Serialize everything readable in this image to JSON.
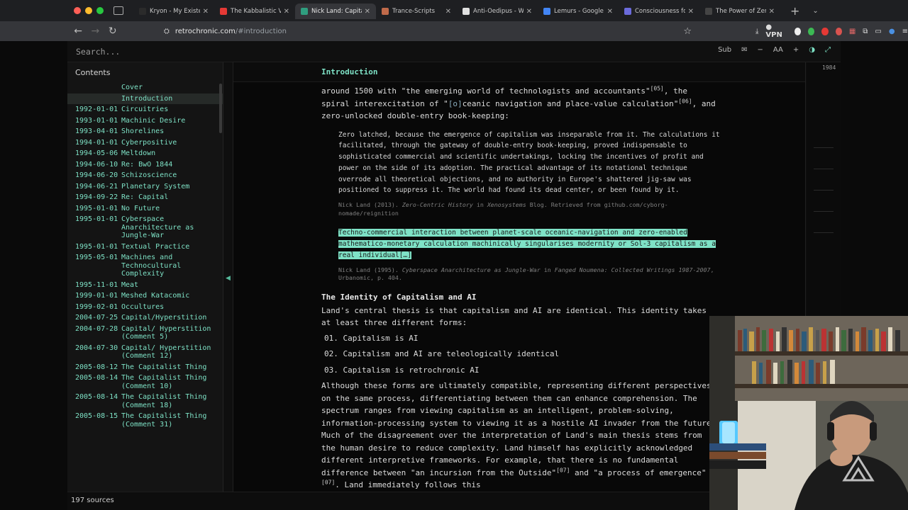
{
  "browser": {
    "tabs": [
      {
        "label": "Kryon - My Existenti",
        "favicon_color": "#2b2b2b",
        "active": false
      },
      {
        "label": "The Kabbalistic Viru",
        "favicon_color": "#e53935",
        "active": false
      },
      {
        "label": "Nick Land: Capitalis",
        "favicon_color": "#2f9e7f",
        "active": true
      },
      {
        "label": "Trance-Scripts",
        "favicon_color": "#c06a4a",
        "active": false
      },
      {
        "label": "Anti-Oedipus - Wikip",
        "favicon_color": "#e0e0e0",
        "active": false
      },
      {
        "label": "Lemurs - Google Sea",
        "favicon_color": "#4285f4",
        "active": false
      },
      {
        "label": "Consciousness for N",
        "favicon_color": "#6b6bdb",
        "active": false
      },
      {
        "label": "The Power of Zero - Chr",
        "favicon_color": "#444444",
        "active": false
      }
    ],
    "url_host": "retrochronic.com",
    "url_path": "/#introduction",
    "vpn_label": "VPN"
  },
  "app": {
    "search_placeholder": "Search...",
    "tools": {
      "sub": "Sub",
      "font": "AA"
    },
    "contents_title": "Contents",
    "toc": [
      {
        "date": "",
        "title": "Cover"
      },
      {
        "date": "",
        "title": "Introduction",
        "active": true
      },
      {
        "date": "1992-01-01",
        "title": "Circuitries"
      },
      {
        "date": "1993-01-01",
        "title": "Machinic Desire"
      },
      {
        "date": "1993-04-01",
        "title": "Shorelines"
      },
      {
        "date": "1994-01-01",
        "title": "Cyberpositive"
      },
      {
        "date": "1994-05-06",
        "title": "Meltdown"
      },
      {
        "date": "1994-06-10",
        "title": "Re: BwO 1844"
      },
      {
        "date": "1994-06-20",
        "title": "Schizoscience"
      },
      {
        "date": "1994-06-21",
        "title": "Planetary System"
      },
      {
        "date": "1994-09-22",
        "title": "Re: Capital"
      },
      {
        "date": "1995-01-01",
        "title": "No Future"
      },
      {
        "date": "1995-01-01",
        "title": "Cyberspace Anarchitecture as Jungle-War"
      },
      {
        "date": "1995-01-01",
        "title": "Textual Practice"
      },
      {
        "date": "1995-05-01",
        "title": "Machines and Technocultural Complexity"
      },
      {
        "date": "1995-11-01",
        "title": "Meat"
      },
      {
        "date": "1999-01-01",
        "title": "Meshed Katacomic"
      },
      {
        "date": "1999-02-01",
        "title": "Occultures"
      },
      {
        "date": "2004-07-25",
        "title": "Capital/Hyperstition"
      },
      {
        "date": "2004-07-28",
        "title": "Capital/ Hyperstition (Comment 5)"
      },
      {
        "date": "2004-07-30",
        "title": "Capital/ Hyperstition (Comment 12)"
      },
      {
        "date": "2005-08-12",
        "title": "The Capitalist Thing"
      },
      {
        "date": "2005-08-14",
        "title": "The Capitalist Thing (Comment 10)"
      },
      {
        "date": "2005-08-14",
        "title": "The Capitalist Thing (Comment 18)"
      },
      {
        "date": "2005-08-15",
        "title": "The Capitalist Thing (Comment 31)"
      }
    ],
    "section_title": "Introduction",
    "right_number": "1984",
    "status": "197 sources"
  },
  "article": {
    "intro_a": "around 1500 with \"the emerging world of technologists and accountants\"",
    "ref_05": "[05]",
    "intro_b": ", the spiral interexcitation of \"",
    "intro_bracket": "[o]",
    "intro_c": "ceanic navigation and place-value calculation\"",
    "ref_06": "[06]",
    "intro_d": ", and zero-unlocked double-entry book-keeping:",
    "quote1": "Zero latched, because the emergence of capitalism was inseparable from it. The calculations it facilitated, through the gateway of double-entry book-keeping, proved indispensable to sophisticated commercial and scientific undertakings, locking the incentives of profit and power on the side of its adoption. The practical advantage of its notational technique overrode all theoretical objections, and no authority in Europe's shattered jig-saw was positioned to suppress it. The world had found its dead center, or been found by it.",
    "cite1_a": "Nick Land (2013). ",
    "cite1_title": "Zero-Centric History",
    "cite1_b": " in ",
    "cite1_pub": "Xenosystems",
    "cite1_c": " Blog. Retrieved from github.com/cyborg-nomade/reignition",
    "quote2": "Techno-commercial interaction between planet-scale oceanic-navigation and zero-enabled mathematico-monetary calculation machinically singularises modernity or Sol-3 capitalism as a real individual",
    "quote2_tail": "[…]",
    "cite2_a": "Nick Land (1995). ",
    "cite2_title": "Cyberspace Anarchitecture as Jungle-War",
    "cite2_b": " in ",
    "cite2_pub": "Fanged Noumena: Collected Writings 1987-2007",
    "cite2_c": ", Urbanomic, p. 404.",
    "heading": "The Identity of Capitalism and AI",
    "identity_intro": "Land's central thesis is that capitalism and AI are identical. This identity takes at least three different forms:",
    "list": [
      "01. Capitalism is AI",
      "02. Capitalism and AI are teleologically identical",
      "03. Capitalism is retrochronic AI"
    ],
    "para_a": "Although these forms are ultimately compatible, representing different perspectives on the same process, differentiating between them can enhance comprehension. The spectrum ranges from viewing capitalism as an intelligent, problem-solving, information-processing system to viewing it as a hostile AI invader from the future. Much of the disagreement over the interpretation of Land's main thesis stems from the human desire to reduce complexity. Land himself has explicitly acknowledged different interpretive frameworks. For example, that there is no fundamental difference between \"an incursion from the Outside\"",
    "ref_07a": "[07]",
    "para_b": " and \"a process of emergence\"",
    "ref_07b": "[07]",
    "para_c": ". Land immediately follows this"
  }
}
